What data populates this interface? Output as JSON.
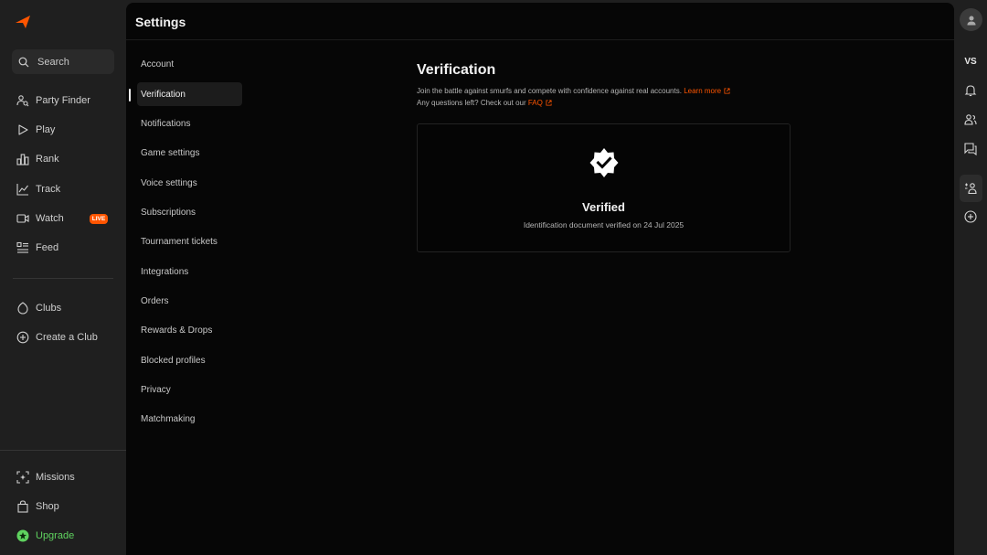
{
  "left_nav": {
    "search_label": "Search",
    "items": [
      {
        "label": "Party Finder",
        "icon": "party-finder-icon"
      },
      {
        "label": "Play",
        "icon": "play-icon"
      },
      {
        "label": "Rank",
        "icon": "rank-icon"
      },
      {
        "label": "Track",
        "icon": "track-icon"
      },
      {
        "label": "Watch",
        "icon": "watch-icon"
      },
      {
        "label": "Feed",
        "icon": "feed-icon"
      }
    ],
    "live_badge": "LIVE",
    "clubs_items": [
      {
        "label": "Clubs",
        "icon": "clubs-icon"
      },
      {
        "label": "Create a Club",
        "icon": "plus-circle-icon"
      }
    ],
    "bottom_items": [
      {
        "label": "Missions",
        "icon": "missions-icon"
      },
      {
        "label": "Shop",
        "icon": "shop-icon"
      },
      {
        "label": "Upgrade",
        "icon": "upgrade-icon"
      }
    ]
  },
  "header": {
    "title": "Settings"
  },
  "settings_menu": [
    "Account",
    "Verification",
    "Notifications",
    "Game settings",
    "Voice settings",
    "Subscriptions",
    "Tournament tickets",
    "Integrations",
    "Orders",
    "Rewards & Drops",
    "Blocked profiles",
    "Privacy",
    "Matchmaking"
  ],
  "settings_menu_active": "Verification",
  "content": {
    "title": "Verification",
    "description": "Join the battle against smurfs and compete with confidence against real accounts.",
    "learn_more": "Learn more",
    "questions": "Any questions left? Check out our",
    "faq": "FAQ",
    "card": {
      "title": "Verified",
      "subtitle": "Identification document verified on 24 Jul 2025"
    }
  },
  "right_rail": {
    "vs_label": "VS"
  },
  "colors": {
    "accent": "#ff5500",
    "upgrade": "#5fd35f"
  }
}
